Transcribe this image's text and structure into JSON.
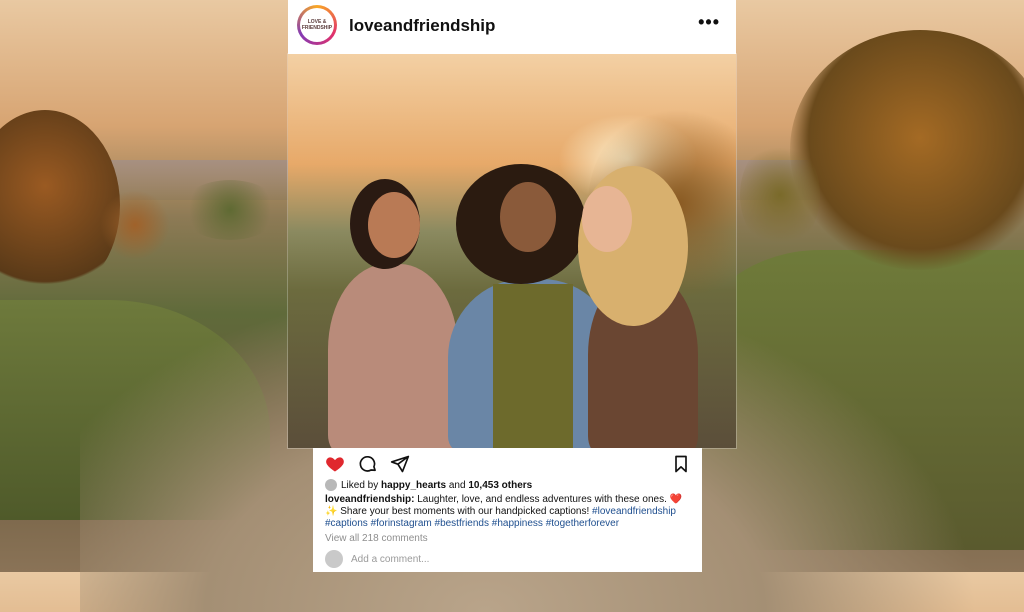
{
  "post": {
    "username": "loveandfriendship",
    "avatar_text_line1": "LOVE &",
    "avatar_text_line2": "FRIENDSHIP",
    "more_icon": "more-horizontal-icon"
  },
  "actions": {
    "like_icon": "heart-filled-icon",
    "comment_icon": "comment-icon",
    "share_icon": "send-icon",
    "save_icon": "bookmark-icon",
    "like_color": "#e0282e"
  },
  "likes": {
    "prefix": "Liked by ",
    "user": "happy_hearts",
    "middle": " and ",
    "count": "10,453 others"
  },
  "caption": {
    "username": "loveandfriendship:",
    "text": " Laughter, love, and endless adventures with these ones. ❤️✨ Share your best moments with our handpicked captions!",
    "hashtags": " #loveandfriendship #captions #forinstagram #bestfriends #happiness #togetherforever"
  },
  "comments": {
    "view_all": "View all 218 comments",
    "add_placeholder": "Add a comment..."
  }
}
